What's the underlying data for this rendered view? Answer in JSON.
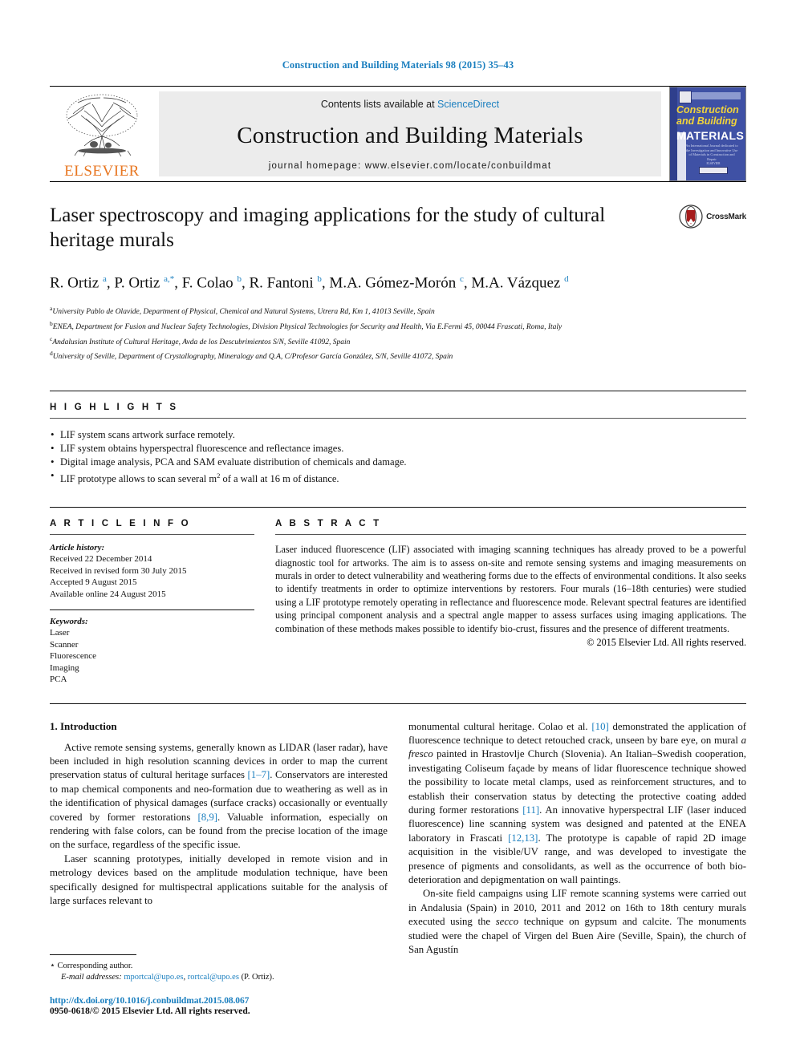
{
  "running_head": "Construction and Building Materials 98 (2015) 35–43",
  "masthead": {
    "publisher_name": "ELSEVIER",
    "contents_prefix": "Contents lists available at ",
    "contents_link": "ScienceDirect",
    "journal_title": "Construction and Building Materials",
    "homepage": "journal homepage: www.elsevier.com/locate/conbuildmat",
    "cover": {
      "line1": "Construction",
      "line2": "and Building",
      "line3": "MATERIALS",
      "blurb": "An International Journal dedicated to the Investigation and Innovative Use of Materials in Construction and Repair",
      "footer": "ELSEVIER"
    }
  },
  "article": {
    "title": "Laser spectroscopy and imaging applications for the study of cultural heritage murals",
    "crossmark_label": "CrossMark",
    "authors_html": "R. Ortiz <sup>a</sup>, P. Ortiz <sup>a,*</sup>, F. Colao <sup>b</sup>, R. Fantoni <sup>b</sup>, M.A. Gómez-Morón <sup>c</sup>, M.A. Vázquez <sup>d</sup>",
    "affiliations": [
      "University Pablo de Olavide, Department of Physical, Chemical and Natural Systems, Utrera Rd, Km 1, 41013 Seville, Spain",
      "ENEA, Department for Fusion and Nuclear Safety Technologies, Division Physical Technologies for Security and Health, Via E.Fermi 45, 00044 Frascati, Roma, Italy",
      "Andalusian Institute of Cultural Heritage, Avda de los Descubrimientos S/N, Seville 41092, Spain",
      "University of Seville, Department of Crystallography, Mineralogy and Q.A, C/Profesor García González, S/N, Seville 41072, Spain"
    ],
    "affiliation_marks": [
      "a",
      "b",
      "c",
      "d"
    ]
  },
  "highlights": {
    "heading": "H I G H L I G H T S",
    "items_html": [
      "LIF system scans artwork surface remotely.",
      "LIF system obtains hyperspectral fluorescence and reflectance images.",
      "Digital image analysis, PCA and SAM evaluate distribution of chemicals and damage.",
      "LIF prototype allows to scan several m<sup>2</sup> of a wall at 16 m of distance."
    ]
  },
  "article_info": {
    "heading": "A R T I C L E    I N F O",
    "history_label": "Article history:",
    "history": [
      "Received 22 December 2014",
      "Received in revised form 30 July 2015",
      "Accepted 9 August 2015",
      "Available online 24 August 2015"
    ],
    "keywords_label": "Keywords:",
    "keywords": [
      "Laser",
      "Scanner",
      "Fluorescence",
      "Imaging",
      "PCA"
    ]
  },
  "abstract": {
    "heading": "A B S T R A C T",
    "text": "Laser induced fluorescence (LIF) associated with imaging scanning techniques has already proved to be a powerful diagnostic tool for artworks. The aim is to assess on-site and remote sensing systems and imaging measurements on murals in order to detect vulnerability and weathering forms due to the effects of environmental conditions. It also seeks to identify treatments in order to optimize interventions by restorers. Four murals (16–18th centuries) were studied using a LIF prototype remotely operating in reflectance and fluorescence mode. Relevant spectral features are identified using principal component analysis and a spectral angle mapper to assess surfaces using imaging applications. The combination of these methods makes possible to identify bio-crust, fissures and the presence of different treatments.",
    "copyright": "© 2015 Elsevier Ltd. All rights reserved."
  },
  "body": {
    "section_title": "1. Introduction",
    "left_paragraphs_html": [
      "Active remote sensing systems, generally known as LIDAR (laser radar), have been included in high resolution scanning devices in order to map the current preservation status of cultural heritage surfaces <span class=\"ref\">[1–7]</span>. Conservators are interested to map chemical components and neo-formation due to weathering as well as in the identification of physical damages (surface cracks) occasionally or eventually covered by former restorations <span class=\"ref\">[8,9]</span>. Valuable information, especially on rendering with false colors, can be found from the precise location of the image on the surface, regardless of the specific issue.",
      "Laser scanning prototypes, initially developed in remote vision and in metrology devices based on the amplitude modulation technique, have been specifically designed for multispectral applications suitable for the analysis of large surfaces relevant to"
    ],
    "right_paragraphs_html": [
      "monumental cultural heritage. Colao et al. <span class=\"ref\">[10]</span> demonstrated the application of fluorescence technique to detect retouched crack, unseen by bare eye, on mural <span class=\"ital\">a fresco</span> painted in Hrastovlje Church (Slovenia). An Italian–Swedish cooperation, investigating Coliseum façade by means of lidar fluorescence technique showed the possibility to locate metal clamps, used as reinforcement structures, and to establish their conservation status by detecting the protective coating added during former restorations <span class=\"ref\">[11]</span>. An innovative hyperspectral LIF (laser induced fluorescence) line scanning system was designed and patented at the ENEA laboratory in Frascati <span class=\"ref\">[12,13]</span>. The prototype is capable of rapid 2D image acquisition in the visible/UV range, and was developed to investigate the presence of pigments and consolidants, as well as the occurrence of both bio-deterioration and depigmentation on wall paintings.",
      "On-site field campaigns using LIF remote scanning systems were carried out in Andalusia (Spain) in 2010, 2011 and 2012 on 16th to 18th century murals executed using the <span class=\"ital\">secco</span> technique on gypsum and calcite. The monuments studied were the chapel of Virgen del Buen Aire (Seville, Spain), the church of San Agustín"
    ]
  },
  "footnotes": {
    "corresponding": "Corresponding author.",
    "email_label": "E-mail addresses:",
    "email1": "mportcal@upo.es",
    "email_sep": ", ",
    "email2": "rortcal@upo.es",
    "email_suffix": " (P. Ortiz).",
    "doi": "http://dx.doi.org/10.1016/j.conbuildmat.2015.08.067",
    "issn": "0950-0618/© 2015 Elsevier Ltd. All rights reserved."
  },
  "colors": {
    "link_blue": "#1b7fbf",
    "elsevier_orange": "#e87722",
    "cover_blue": "#3f51a5",
    "crossmark_red": "#a61c1c"
  }
}
